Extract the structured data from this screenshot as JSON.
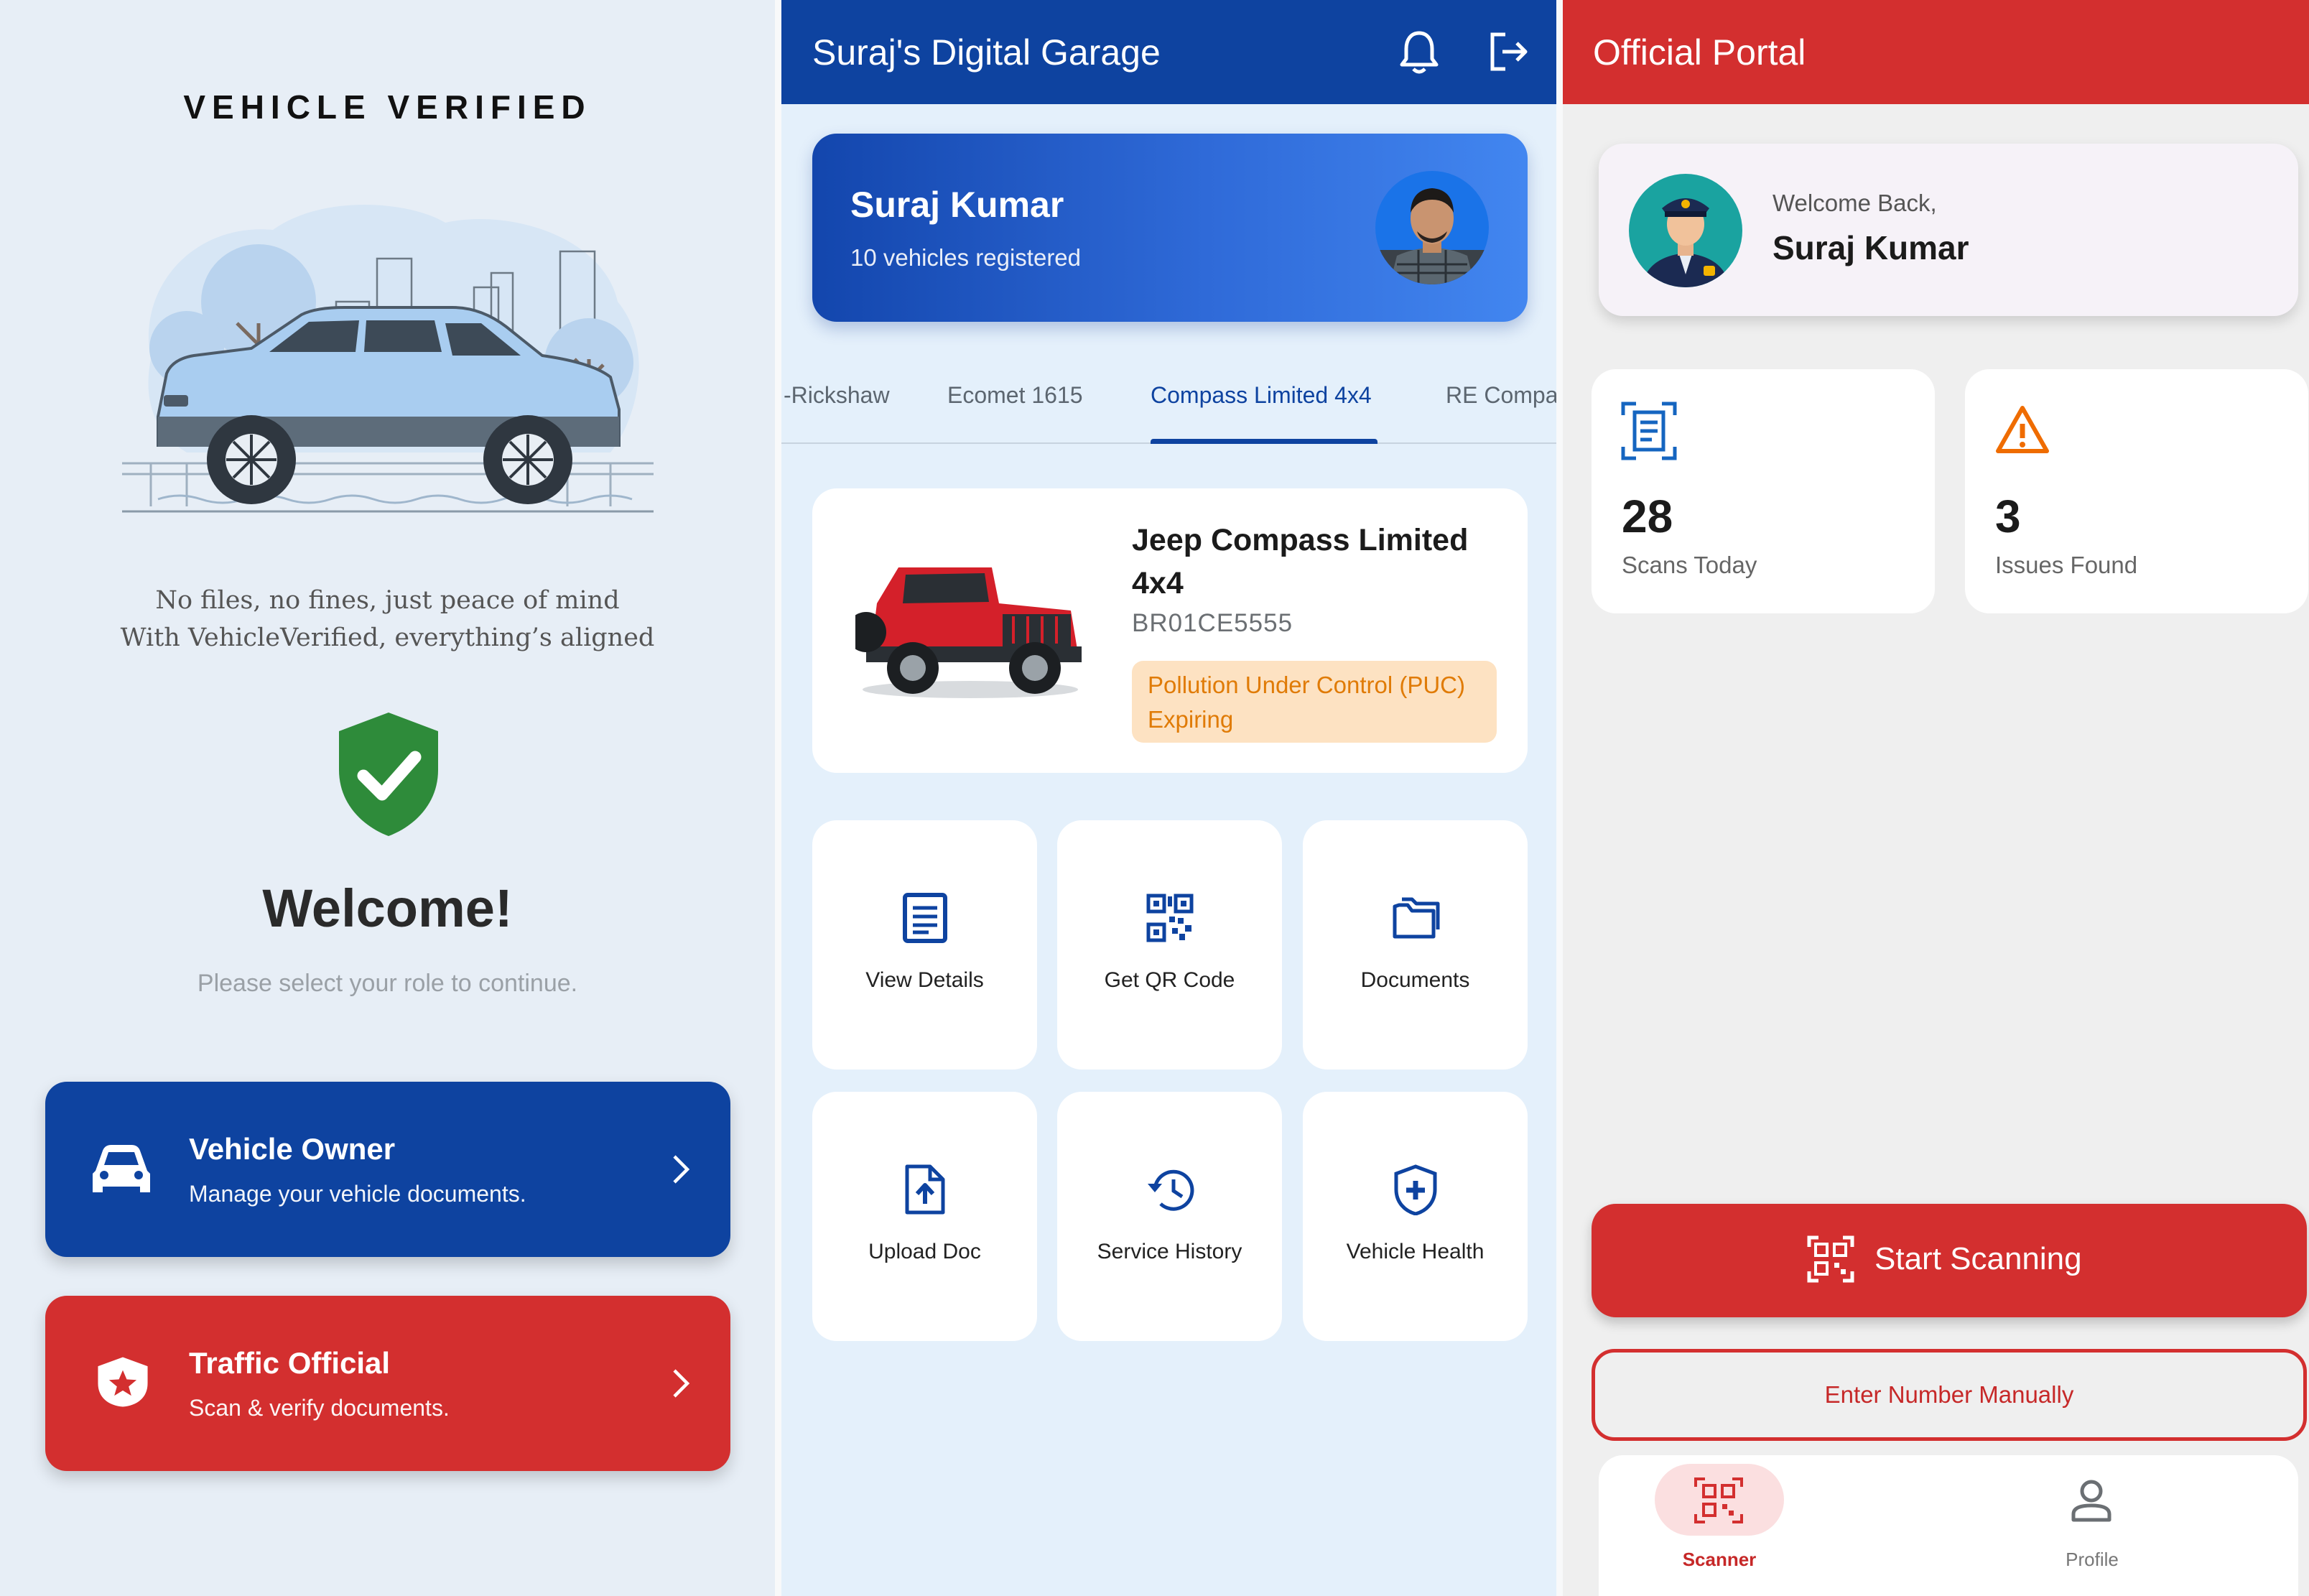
{
  "role_screen": {
    "title": "VEHICLE VERIFIED",
    "tagline_1": "No files, no fines, just peace of mind",
    "tagline_2": "With VehicleVerified, everything’s aligned",
    "welcome": "Welcome!",
    "subtitle": "Please select your role to continue.",
    "roles": [
      {
        "title": "Vehicle Owner",
        "subtitle": "Manage your vehicle documents.",
        "icon": "car-icon",
        "color": "#0e43a0"
      },
      {
        "title": "Traffic Official",
        "subtitle": "Scan & verify documents.",
        "icon": "badge-star-icon",
        "color": "#d32f2f"
      }
    ]
  },
  "garage_screen": {
    "app_title": "Suraj's Digital Garage",
    "icons": [
      "bell-icon",
      "logout-icon"
    ],
    "profile": {
      "name": "Suraj Kumar",
      "vehicle_count": "10 vehicles registered"
    },
    "tabs": [
      "-Rickshaw",
      "Ecomet 1615",
      "Compass Limited 4x4",
      "RE Compa"
    ],
    "active_tab": 2,
    "vehicle": {
      "name": "Jeep Compass Limited 4x4",
      "plate": "BR01CE5555",
      "status": "Pollution Under Control (PUC) Expiring"
    },
    "actions": [
      {
        "label": "View Details",
        "icon": "document-list-icon"
      },
      {
        "label": "Get QR Code",
        "icon": "qr-code-icon"
      },
      {
        "label": "Documents",
        "icon": "folder-icon"
      },
      {
        "label": "Upload Doc",
        "icon": "file-upload-icon"
      },
      {
        "label": "Service History",
        "icon": "history-icon"
      },
      {
        "label": "Vehicle Health",
        "icon": "health-shield-icon"
      }
    ],
    "accent": "#0e43a0"
  },
  "official_screen": {
    "app_title": "Official Portal",
    "welcome_back": "Welcome Back,",
    "user_name": "Suraj Kumar",
    "stats": [
      {
        "value": "28",
        "label": "Scans Today",
        "icon": "scan-document-icon"
      },
      {
        "value": "3",
        "label": "Issues Found",
        "icon": "warning-icon"
      }
    ],
    "primary_button": "Start Scanning",
    "secondary_button": "Enter Number Manually",
    "nav": [
      {
        "label": "Scanner",
        "icon": "qr-scanner-icon",
        "active": true
      },
      {
        "label": "Profile",
        "icon": "person-icon",
        "active": false
      }
    ],
    "accent": "#d32f2f"
  }
}
